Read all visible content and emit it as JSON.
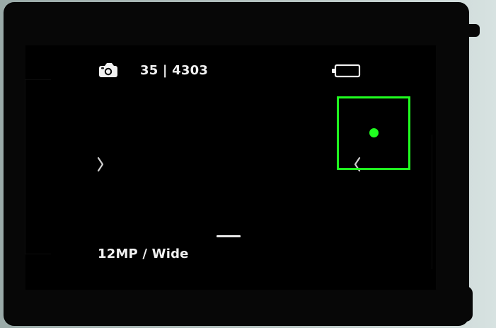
{
  "status": {
    "mode_icon": "camera-icon",
    "counter_text": "35 | 4303",
    "battery_icon": "battery-icon"
  },
  "navigation": {
    "left_icon": "chevron-left-icon",
    "right_icon": "chevron-right-icon"
  },
  "settings": {
    "capture_settings_label": "12MP / Wide"
  },
  "colors": {
    "overlay_green": "#20ff20",
    "text": "#f1f1f1",
    "screen_bg": "#000000"
  }
}
